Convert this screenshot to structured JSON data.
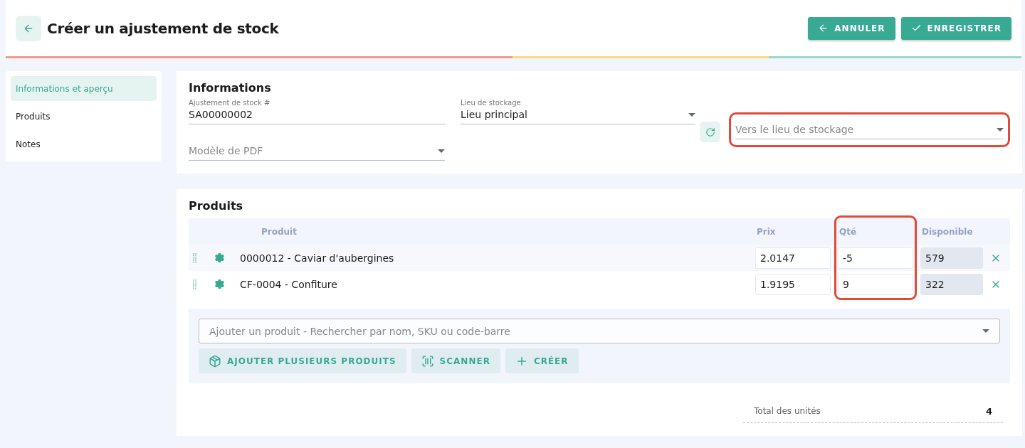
{
  "header": {
    "title": "Créer un ajustement de stock",
    "buttons": [
      {
        "kind": "cancel",
        "label": "ANNULER"
      },
      {
        "kind": "save",
        "label": "ENREGISTRER"
      }
    ]
  },
  "sidebar": {
    "items": [
      {
        "label": "Informations et aperçu",
        "selected": true
      },
      {
        "label": "Produits",
        "selected": false
      },
      {
        "label": "Notes",
        "selected": false
      }
    ]
  },
  "informations": {
    "title": "Informations",
    "adjustment_number": {
      "label": "Ajustement de stock #",
      "value": "SA00000002"
    },
    "location": {
      "label": "Lieu de stockage",
      "value": "Lieu principal"
    },
    "destination": {
      "placeholder": "Vers le lieu de stockage",
      "highlighted": true
    },
    "pdf_template": {
      "placeholder": "Modèle de PDF"
    }
  },
  "products": {
    "title": "Produits",
    "columns": [
      "Produit",
      "Prix",
      "Qté",
      "Disponible"
    ],
    "qty_highlighted": true,
    "rows": [
      {
        "product": "0000012 - Caviar d'aubergines",
        "price": "2.0147",
        "qty": "-5",
        "available": "579"
      },
      {
        "product": "CF-0004 - Confiture",
        "price": "1.9195",
        "qty": "9",
        "available": "322"
      }
    ],
    "search": {
      "placeholder": "Ajouter un produit - Rechercher par nom, SKU ou code-barre"
    },
    "actions": [
      {
        "kind": "bulk",
        "label": "AJOUTER PLUSIEURS PRODUITS"
      },
      {
        "kind": "scan",
        "label": "SCANNER"
      },
      {
        "kind": "create",
        "label": "CRÉER"
      }
    ],
    "total": {
      "label": "Total des unités",
      "value": "4"
    }
  }
}
